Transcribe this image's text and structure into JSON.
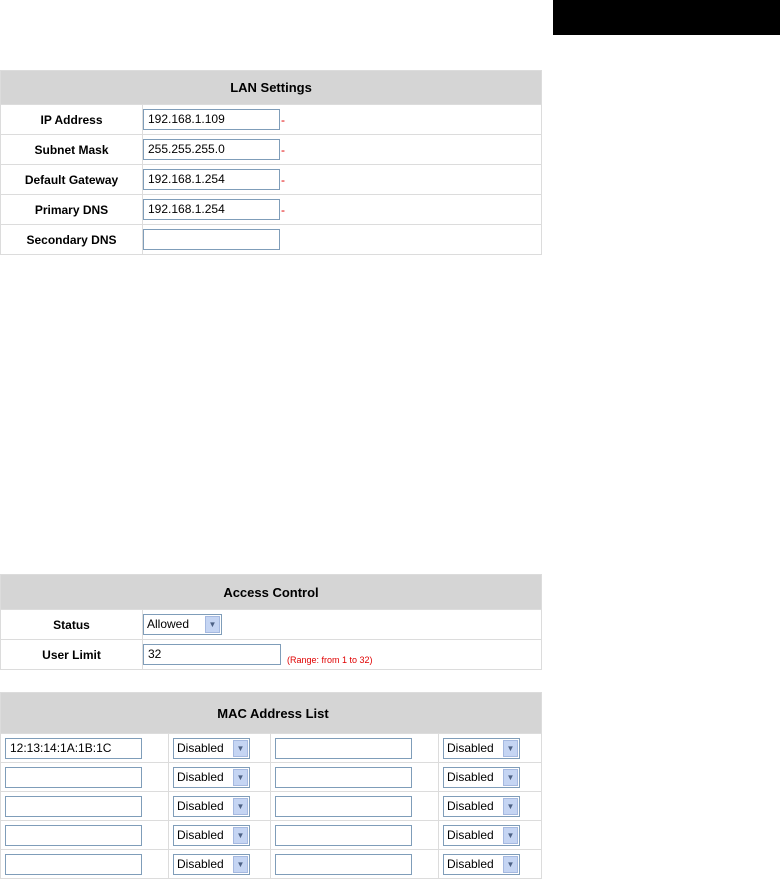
{
  "lan": {
    "title": "LAN Settings",
    "rows": [
      {
        "label": "IP Address",
        "value": "192.168.1.109",
        "required": "-"
      },
      {
        "label": "Subnet Mask",
        "value": "255.255.255.0",
        "required": "-"
      },
      {
        "label": "Default Gateway",
        "value": "192.168.1.254",
        "required": "-"
      },
      {
        "label": "Primary DNS",
        "value": "192.168.1.254",
        "required": "-"
      },
      {
        "label": "Secondary DNS",
        "value": "",
        "required": ""
      }
    ]
  },
  "access_control": {
    "title": "Access Control",
    "status_label": "Status",
    "status_value": "Allowed",
    "user_limit_label": "User Limit",
    "user_limit_value": "32",
    "user_limit_hint": "(Range: from 1 to 32)"
  },
  "mac_list": {
    "title": "MAC Address List",
    "rows": [
      {
        "mac1": "12:13:14:1A:1B:1C",
        "state1": "Disabled",
        "mac2": "",
        "state2": "Disabled"
      },
      {
        "mac1": "",
        "state1": "Disabled",
        "mac2": "",
        "state2": "Disabled"
      },
      {
        "mac1": "",
        "state1": "Disabled",
        "mac2": "",
        "state2": "Disabled"
      },
      {
        "mac1": "",
        "state1": "Disabled",
        "mac2": "",
        "state2": "Disabled"
      },
      {
        "mac1": "",
        "state1": "Disabled",
        "mac2": "",
        "state2": "Disabled"
      }
    ]
  },
  "icons": {
    "dropdown": "chevron-down-icon"
  }
}
